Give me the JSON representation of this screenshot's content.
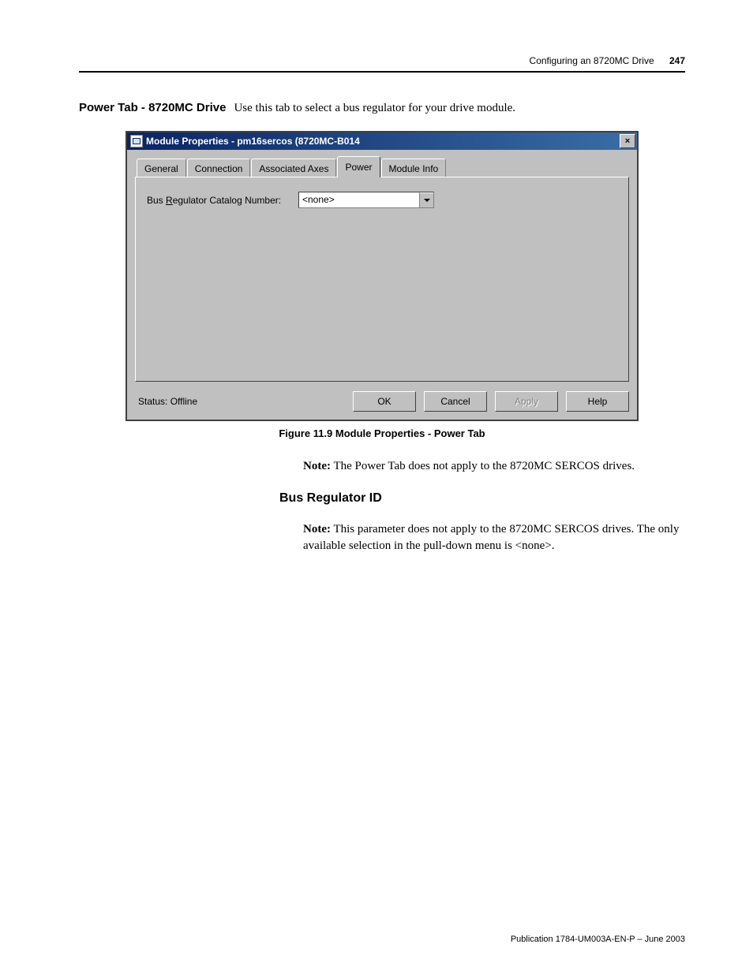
{
  "header": {
    "running_title": "Configuring an 8720MC Drive",
    "page_number": "247"
  },
  "section": {
    "heading": "Power Tab - 8720MC Drive",
    "intro": "Use this tab to select a bus regulator for your drive module."
  },
  "dialog": {
    "title": "Module Properties - pm16sercos (8720MC-B014",
    "tabs": {
      "general": "General",
      "connection": "Connection",
      "associated": "Associated Axes",
      "power": "Power",
      "moduleinfo": "Module Info"
    },
    "field_label_prefix": "Bus ",
    "field_label_ul": "R",
    "field_label_suffix": "egulator Catalog Number:",
    "combo_value": "<none>",
    "status_label": "Status:  Offline",
    "buttons": {
      "ok": "OK",
      "cancel": "Cancel",
      "apply": "Apply",
      "help": "Help"
    }
  },
  "figure_caption": "Figure 11.9 Module Properties - Power Tab",
  "note1_label": "Note:",
  "note1_text": " The Power Tab does not apply to the 8720MC SERCOS drives.",
  "sub_heading": "Bus Regulator ID",
  "note2_label": "Note:",
  "note2_text": " This parameter does not apply to the 8720MC SERCOS drives. The only available selection in the pull-down menu is <none>.",
  "footer": "Publication 1784-UM003A-EN-P – June 2003"
}
